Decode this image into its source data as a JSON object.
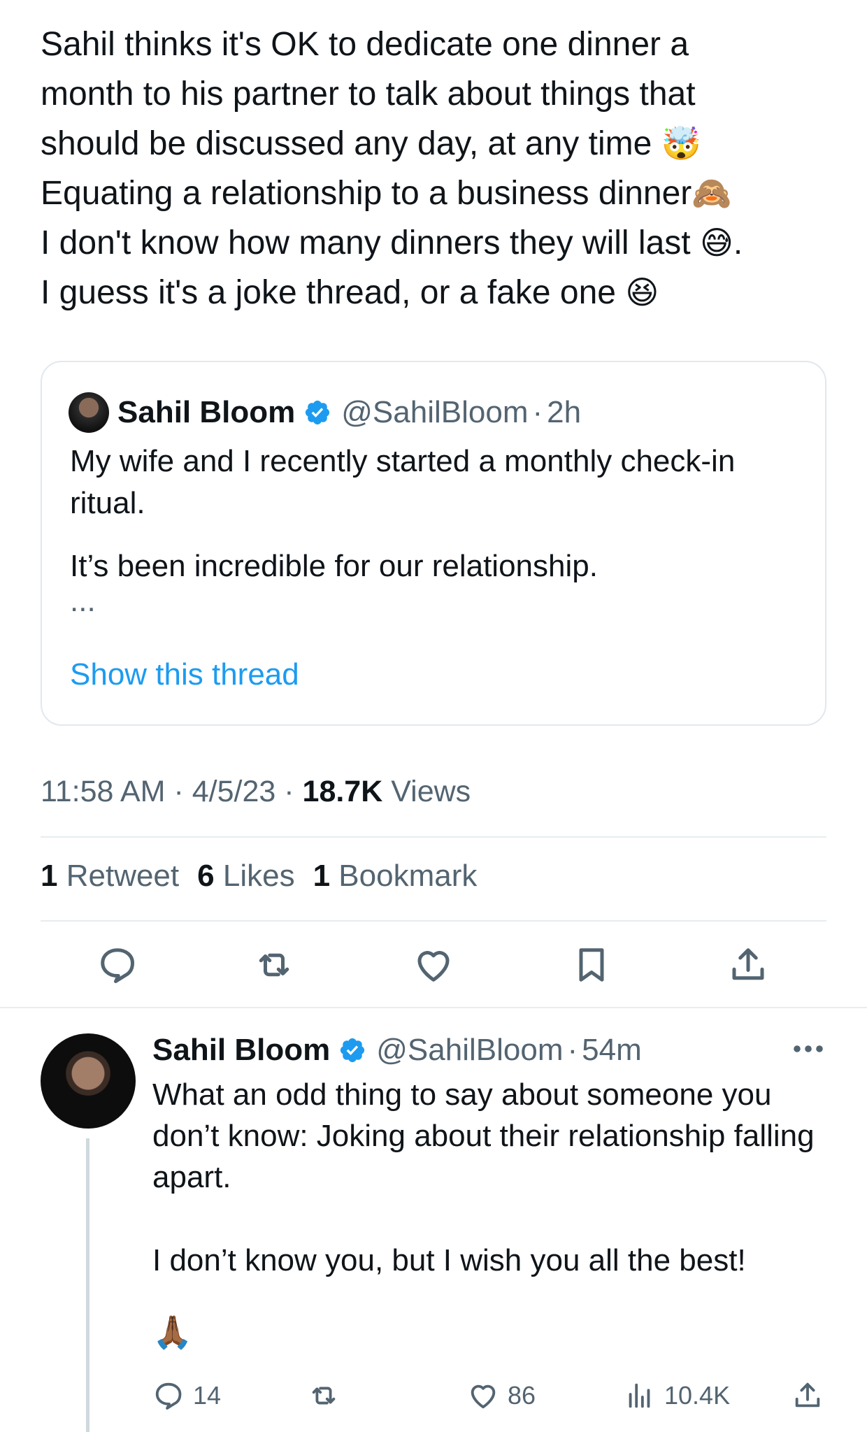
{
  "tweet": {
    "lines": [
      "Sahil thinks it's OK to dedicate one dinner a",
      "month to his partner to talk about things that",
      "should be discussed any day, at any time",
      "Equating a relationship to a business dinner",
      "I don't know how many dinners they will last",
      "I guess it's a joke thread, or a fake one"
    ],
    "emoji_1": "🤯",
    "emoji_2": "🙈",
    "emoji_3": "😅",
    "emoji_3_suffix": ".",
    "emoji_4": "😆"
  },
  "quoted": {
    "name": "Sahil Bloom",
    "handle": "@SahilBloom",
    "separator": "·",
    "time": "2h",
    "body_line_1": "My wife and I recently started a monthly check-in ritual.",
    "body_line_2": "It’s been incredible for our relationship.",
    "ellipsis": "...",
    "show_thread": "Show this thread"
  },
  "meta": {
    "time": "11:58 AM",
    "sep": "·",
    "date": "4/5/23",
    "views_count": "18.7K",
    "views_label": "Views"
  },
  "stats": {
    "retweets_count": "1",
    "retweets_label": "Retweet",
    "likes_count": "6",
    "likes_label": "Likes",
    "bookmarks_count": "1",
    "bookmarks_label": "Bookmark"
  },
  "reply": {
    "name": "Sahil Bloom",
    "handle": "@SahilBloom",
    "separator": "·",
    "time": "54m",
    "body_line_1": "What an odd thing to say about someone you don’t know: Joking about their relationship falling apart.",
    "body_line_2": "I don’t know you, but I wish you all the best!",
    "emoji": "🙏🏾",
    "replies": "14",
    "likes": "86",
    "views": "10.4K"
  },
  "colors": {
    "accent": "#1d9bf0",
    "secondary_text": "#536471",
    "primary_text": "#0f1419",
    "border": "#e1e8ed"
  },
  "icons": [
    "verified-badge-icon",
    "reply-icon",
    "retweet-icon",
    "like-icon",
    "bookmark-icon",
    "share-icon",
    "more-icon",
    "views-icon"
  ]
}
